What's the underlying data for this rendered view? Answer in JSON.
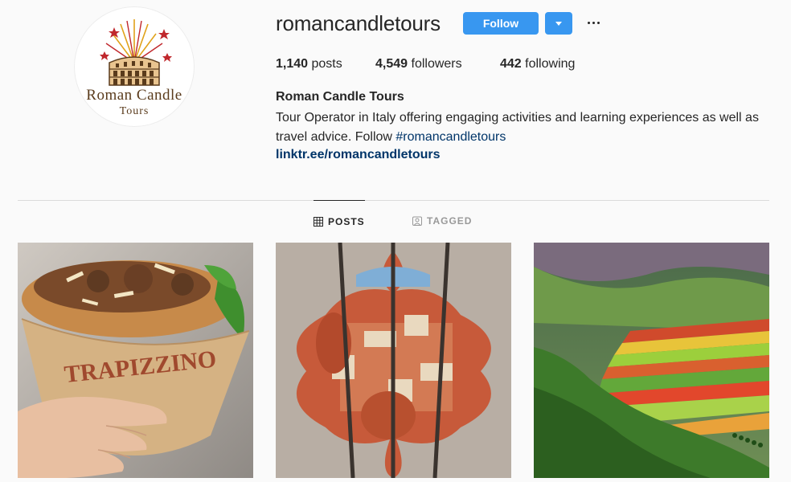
{
  "profile": {
    "username": "romancandletours",
    "follow_label": "Follow",
    "stats": {
      "posts_count": "1,140",
      "posts_label": "posts",
      "followers_count": "4,549",
      "followers_label": "followers",
      "following_count": "442",
      "following_label": "following"
    },
    "full_name": "Roman Candle Tours",
    "bio_text": "Tour Operator in Italy offering engaging activities and learning experiences as well as travel advice. Follow ",
    "bio_hashtag": "#romancandletours",
    "link": "linktr.ee/romancandletours",
    "avatar_logo": {
      "line1": "Roman Candle",
      "line2": "Tours"
    }
  },
  "tabs": [
    {
      "label": "POSTS",
      "icon": "grid-icon",
      "active": true
    },
    {
      "label": "TAGGED",
      "icon": "tagged-icon",
      "active": false
    }
  ],
  "posts": [
    {
      "subject": "trapizzino",
      "wrapper_text": "TRAPIZZINO"
    },
    {
      "subject": "florence-duomo-view"
    },
    {
      "subject": "castelluccio-fields"
    }
  ],
  "colors": {
    "accent": "#3897f0",
    "link": "#003569",
    "text": "#262626",
    "muted": "#999999",
    "background": "#fafafa"
  }
}
